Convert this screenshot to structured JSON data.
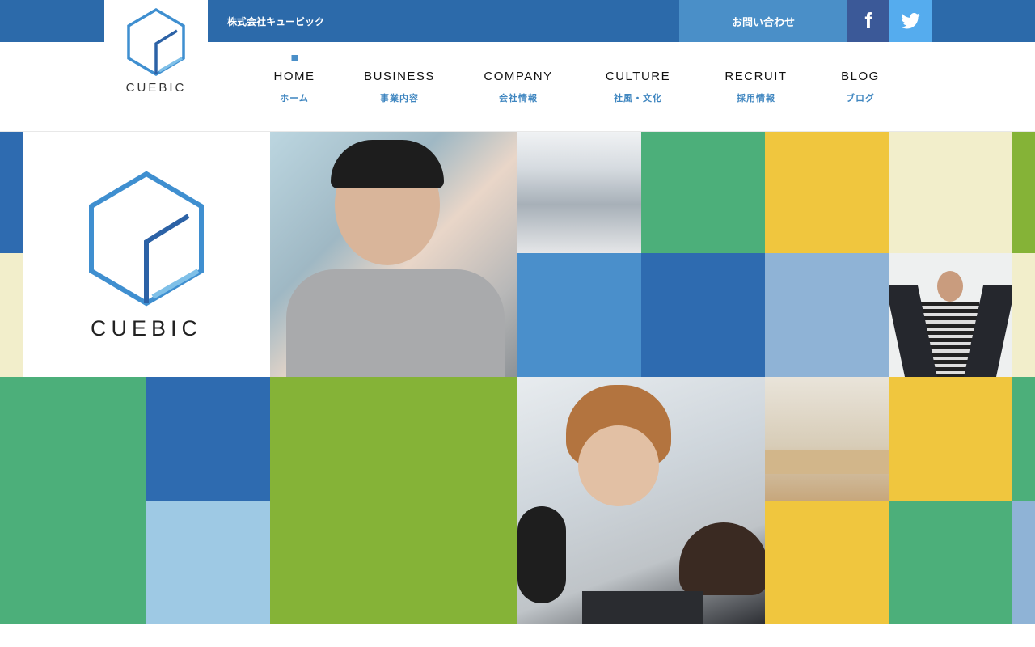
{
  "header": {
    "logo_text": "CUEBIC",
    "company_name": "株式会社キュービック",
    "contact_label": "お問い合わせ",
    "facebook_icon": "facebook-icon",
    "twitter_icon": "twitter-icon"
  },
  "nav": {
    "items": [
      {
        "en": "HOME",
        "ja": "ホーム",
        "active": true
      },
      {
        "en": "BUSINESS",
        "ja": "事業内容"
      },
      {
        "en": "COMPANY",
        "ja": "会社情報"
      },
      {
        "en": "CULTURE",
        "ja": "社風・文化"
      },
      {
        "en": "RECRUIT",
        "ja": "採用情報"
      },
      {
        "en": "BLOG",
        "ja": "ブログ"
      }
    ]
  },
  "hero": {
    "logo_text": "CUEBIC",
    "colors": {
      "blue": "#2e6bb0",
      "mid_blue": "#4a8fcb",
      "light_blue": "#9ec9e4",
      "pale_blue": "#8fb3d6",
      "green": "#4caf7a",
      "lime": "#85b337",
      "yellow": "#f0c63e",
      "beige": "#f2eecb"
    }
  }
}
